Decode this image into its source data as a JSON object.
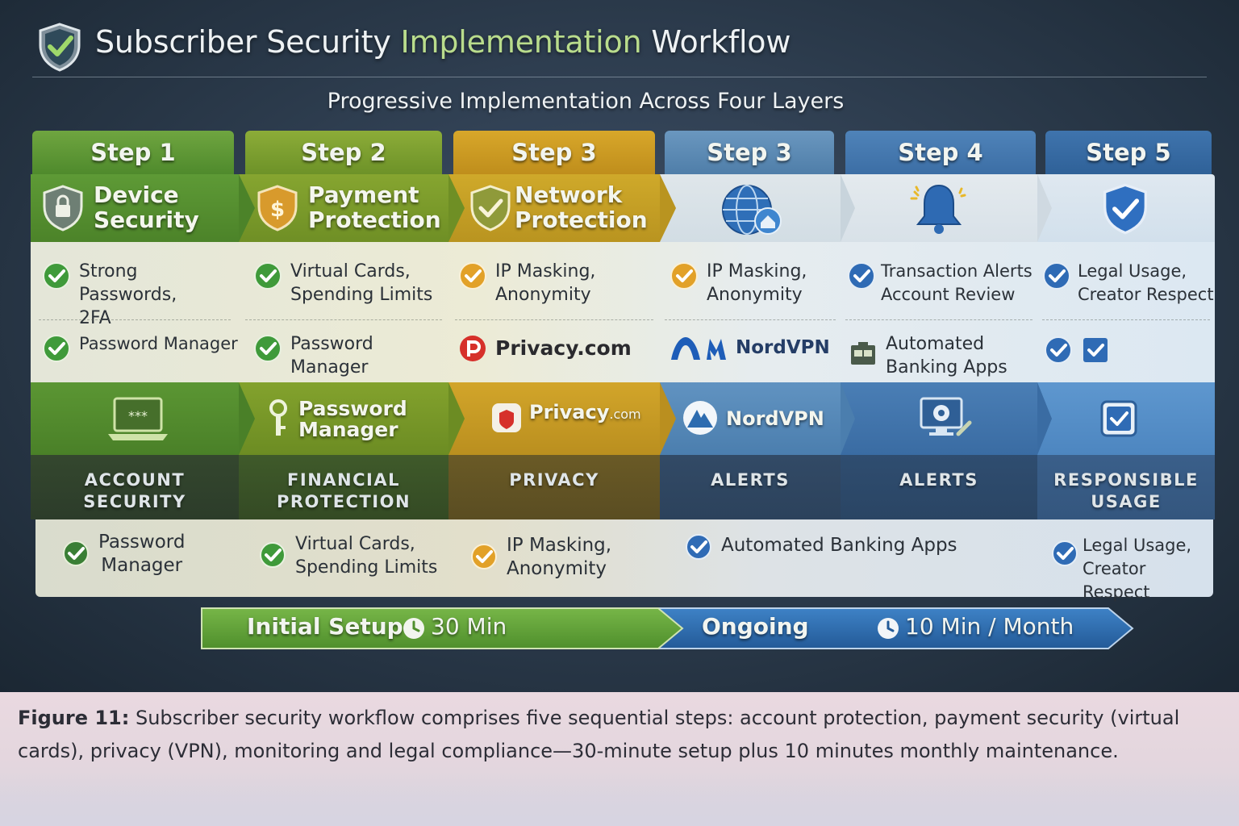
{
  "header": {
    "title_part1": "Subscriber Security ",
    "title_highlight": "Implementation",
    "title_part2": " Workflow",
    "subtitle": "Progressive Implementation Across Four Layers"
  },
  "columns": [
    {
      "step": "Step 1",
      "heading": [
        "Device",
        "Security"
      ],
      "items": [
        [
          "Strong Passwords,",
          "2FA"
        ],
        [
          "Password Manager"
        ]
      ],
      "tool": "",
      "category": [
        "ACCOUNT",
        "SECURITY"
      ],
      "bottom": [
        "Password",
        "Manager"
      ]
    },
    {
      "step": "Step 2",
      "heading": [
        "Payment",
        "Protection"
      ],
      "items": [
        [
          "Virtual Cards,",
          "Spending Limits"
        ],
        [
          "Password",
          "Manager"
        ]
      ],
      "tool": [
        "Password",
        "Manager"
      ],
      "category": [
        "FINANCIAL",
        "PROTECTION"
      ],
      "bottom": [
        "Virtual Cards,",
        "Spending Limits"
      ]
    },
    {
      "step": "Step 3",
      "heading": [
        "Network",
        "Protection"
      ],
      "items": [
        [
          "IP Masking,",
          "Anonymity"
        ],
        [
          "Privacy.com"
        ]
      ],
      "tool": "Privacy",
      "tool_suffix": ".com",
      "category": [
        "PRIVACY"
      ],
      "bottom": [
        "IP Masking,",
        "Anonymity"
      ]
    },
    {
      "step": "Step 3",
      "heading": [],
      "items": [
        [
          "IP Masking,",
          "Anonymity"
        ],
        [
          "NordVPN"
        ]
      ],
      "tool": "NordVPN",
      "category": [
        "ALERTS"
      ],
      "bottom": [
        "Automated Banking Apps"
      ]
    },
    {
      "step": "Step 4",
      "heading": [],
      "items": [
        [
          "Transaction Alerts",
          "Account Review"
        ],
        [
          "Automated",
          "Banking Apps"
        ]
      ],
      "tool": "",
      "category": [
        "ALERTS"
      ],
      "bottom": []
    },
    {
      "step": "Step 5",
      "heading": [],
      "items": [
        [
          "Legal Usage,",
          "Creator Respect"
        ],
        []
      ],
      "tool": "",
      "category": [
        "RESPONSIBLE",
        "USAGE"
      ],
      "bottom": [
        "Legal Usage,",
        "Creator Respect"
      ]
    }
  ],
  "timeline": {
    "initial_label": "Initial Setup",
    "initial_time": "30 Min",
    "ongoing_label": "Ongoing",
    "ongoing_time": "10 Min / Month"
  },
  "caption": {
    "label": "Figure 11:",
    "text": " Subscriber security workflow comprises five sequential steps: account protection, payment security (virtual cards), privacy (VPN), monitoring and legal compliance—30-minute setup plus 10 minutes monthly maintenance."
  },
  "colors": {
    "green": "#5f9a35",
    "olive": "#8aa52c",
    "gold": "#d0a020",
    "blue": "#5a8bb7",
    "blue_mid": "#4a7bb0",
    "blue_light": "#6aa2d2",
    "check_green": "#3f9a3a",
    "check_orange": "#e2a128",
    "check_blue": "#2f6bb5",
    "timeline_green": "#5fa33a",
    "timeline_blue": "#2d6cb0"
  },
  "icons": {
    "header": "shield-check-icon",
    "col1_heading": "shield-lock-icon",
    "col2_heading": "shield-dollar-icon",
    "col3_heading": "shield-check-icon",
    "col4_heading": "globe-home-icon",
    "col5_heading": "bell-icon",
    "col6_heading": "shield-check-icon",
    "col1_tool": "laptop-password-icon",
    "col2_tool": "key-icon",
    "col3_tool": "privacy-logo-icon",
    "col4_tool": "nordvpn-logo-icon",
    "col5_tool": "monitor-gear-icon",
    "col6_tool": "checkbox-icon",
    "clock": "clock-icon"
  }
}
